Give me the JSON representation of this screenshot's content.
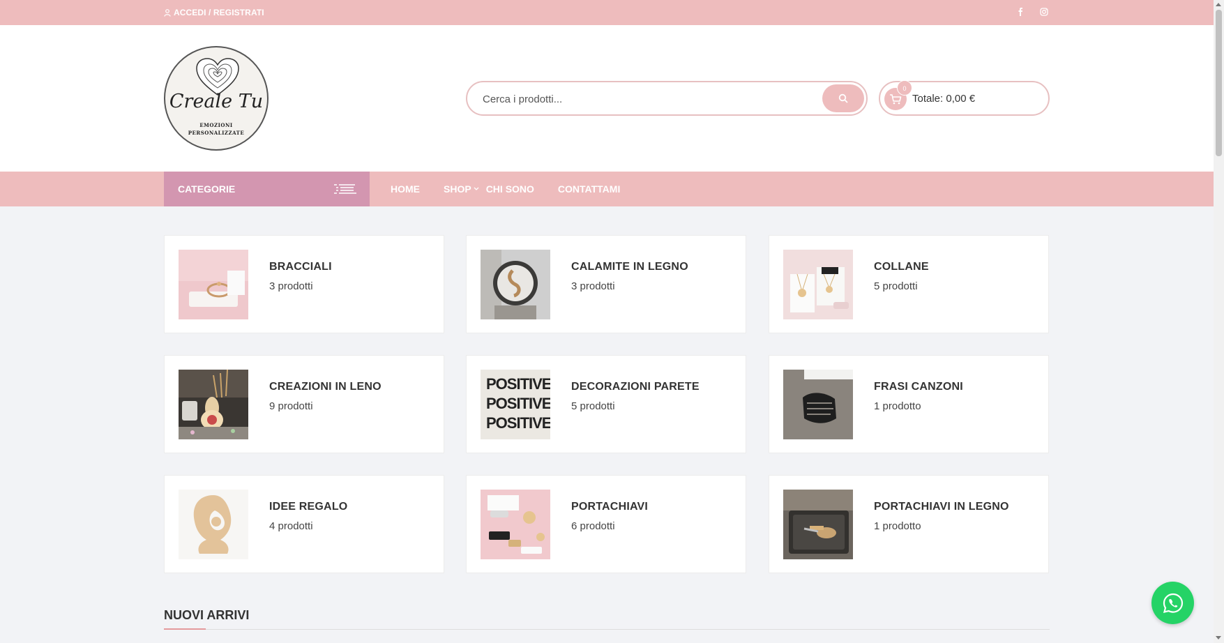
{
  "topbar": {
    "login_label": "ACCEDI / REGISTRATI",
    "social_icons": [
      "facebook-icon",
      "instagram-icon"
    ]
  },
  "logo": {
    "script_text": "Creale Tu",
    "tagline_line1": "EMOZIONI",
    "tagline_line2": "PERSONALIZZATE"
  },
  "search": {
    "placeholder": "Cerca i prodotti..."
  },
  "cart": {
    "count": "0",
    "total_label": "Totale: 0,00 €"
  },
  "nav": {
    "categories_label": "CATEGORIE",
    "links": [
      "HOME",
      "SHOP",
      "CHI SONO",
      "CONTATTAMI"
    ]
  },
  "categories": [
    {
      "title": "BRACCIALI",
      "count": "3 prodotti"
    },
    {
      "title": "CALAMITE IN LEGNO",
      "count": "3 prodotti"
    },
    {
      "title": "COLLANE",
      "count": "5 prodotti"
    },
    {
      "title": "CREAZIONI IN LENO",
      "count": "9 prodotti"
    },
    {
      "title": "DECORAZIONI PARETE",
      "count": "5 prodotti"
    },
    {
      "title": "FRASI CANZONI",
      "count": "1 prodotto"
    },
    {
      "title": "IDEE REGALO",
      "count": "4 prodotti"
    },
    {
      "title": "PORTACHIAVI",
      "count": "6 prodotti"
    },
    {
      "title": "PORTACHIAVI IN LEGNO",
      "count": "1 prodotto"
    }
  ],
  "new_arrivals": {
    "title": "NUOVI ARRIVI"
  },
  "colors": {
    "topbar": "#eebcbd",
    "categorie": "#d396b0",
    "whatsapp": "#25d366"
  }
}
